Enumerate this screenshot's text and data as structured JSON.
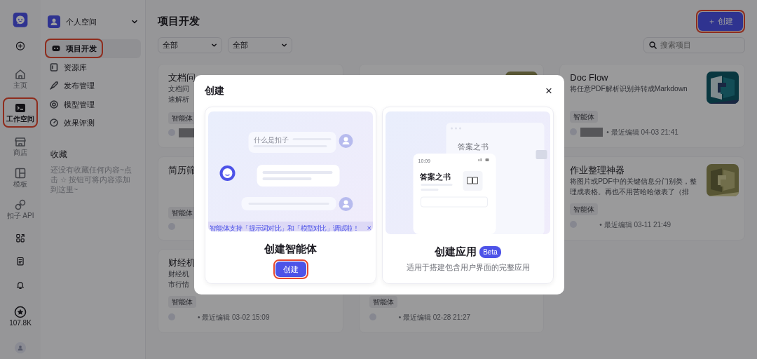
{
  "rail": {
    "nav": [
      {
        "label": "主页",
        "selected": false,
        "highlighted": false
      },
      {
        "label": "工作空间",
        "selected": true,
        "highlighted": true
      },
      {
        "label": "商店",
        "selected": false,
        "highlighted": false
      },
      {
        "label": "模板",
        "selected": false,
        "highlighted": false
      },
      {
        "label": "扣子 API",
        "selected": false,
        "highlighted": false
      }
    ],
    "star_count": "107.8K"
  },
  "sidebar": {
    "space": "个人空间",
    "nav": [
      {
        "label": "项目开发",
        "selected": true,
        "highlighted": true
      },
      {
        "label": "资源库",
        "selected": false,
        "highlighted": false
      },
      {
        "label": "发布管理",
        "selected": false,
        "highlighted": false
      },
      {
        "label": "模型管理",
        "selected": false,
        "highlighted": false
      },
      {
        "label": "效果评测",
        "selected": false,
        "highlighted": false
      }
    ],
    "favorites": {
      "title": "收藏",
      "empty_text": "还没有收藏任何内容~点击 ☆ 按钮可将内容添加到这里~"
    }
  },
  "main": {
    "title": "项目开发",
    "create_button": {
      "label": "＋ 创建",
      "highlighted": true
    },
    "filters": [
      {
        "value": "全部"
      },
      {
        "value": "全部"
      }
    ],
    "search": {
      "placeholder": "搜索项目"
    },
    "cards": [
      {
        "title": "文档问",
        "description": [
          "文档问",
          "速解析"
        ],
        "tag": "智能体",
        "name_hidden": true
      },
      {
        "image": {
          "kind": "picture"
        }
      },
      {
        "title": "Doc Flow",
        "description": [
          "将任意PDF解析识别并转成Markdown"
        ],
        "tag": "智能体",
        "name_hidden": true,
        "edited": "• 最近编辑 04-03 21:41",
        "image": {
          "kind": "picture"
        }
      },
      {
        "title": "简历筛",
        "tag": "智能体",
        "name_hidden": false
      },
      {
        "title": "作业整理神器",
        "description": [
          "将图片或PDF中的关键信息分门别类，整",
          "理成表格。再也不用苦哈哈做表了（排"
        ],
        "tag": "智能体",
        "name_hidden": false,
        "edited": "• 最近编辑 03-11 21:49",
        "image": {
          "kind": "picture"
        }
      },
      {
        "title": "财经机",
        "description": [
          "财经机",
          "市行情"
        ],
        "tag": "智能体",
        "name_hidden": false,
        "edited": "• 最近编辑 03-02 15:09"
      },
      {
        "tag": "智能体",
        "name_hidden": false,
        "edited": "• 最近编辑 02-28 21:27"
      }
    ]
  },
  "modal": {
    "title": "创建",
    "close": "×",
    "options": [
      {
        "kind": "agent",
        "title": "创建智能体",
        "button": {
          "label": "创建",
          "highlighted": true
        },
        "banner": {
          "text": "智能体支持「提示词对比」和「模型对比」调试啦！",
          "close": "×"
        },
        "preview": {
          "question": "什么是扣子"
        }
      },
      {
        "kind": "app",
        "title": "创建应用",
        "badge": "Beta",
        "description": "适用于搭建包含用户界面的完整应用",
        "preview": {
          "back_title": "答案之书",
          "time": "10:09",
          "front_title": "答案之书"
        }
      }
    ]
  }
}
